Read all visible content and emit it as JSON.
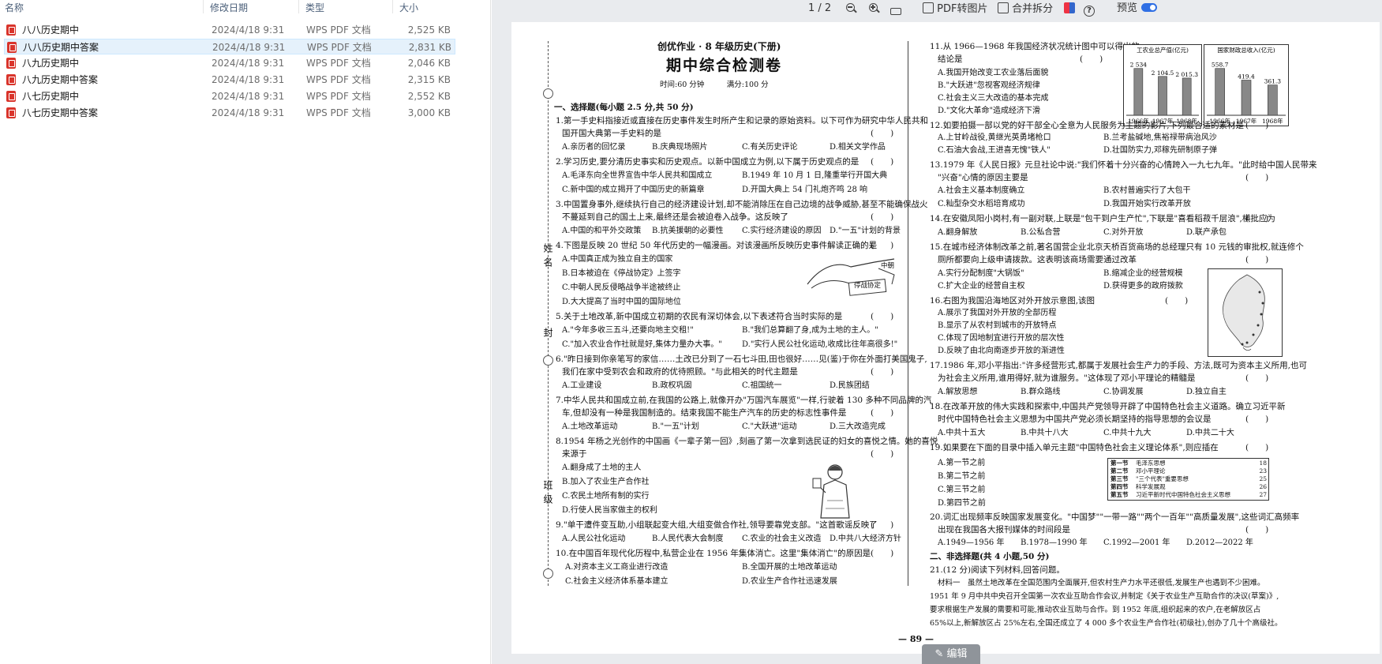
{
  "file_list": {
    "headers": {
      "name": "名称",
      "date": "修改日期",
      "type": "类型",
      "size": "大小"
    },
    "rows": [
      {
        "name": "八八历史期中",
        "date": "2024/4/18 9:31",
        "type": "WPS PDF 文档",
        "size": "2,525 KB"
      },
      {
        "name": "八八历史期中答案",
        "date": "2024/4/18 9:31",
        "type": "WPS PDF 文档",
        "size": "2,831 KB"
      },
      {
        "name": "八九历史期中",
        "date": "2024/4/18 9:31",
        "type": "WPS PDF 文档",
        "size": "2,046 KB"
      },
      {
        "name": "八九历史期中答案",
        "date": "2024/4/18 9:31",
        "type": "WPS PDF 文档",
        "size": "2,315 KB"
      },
      {
        "name": "八七历史期中",
        "date": "2024/4/18 9:31",
        "type": "WPS PDF 文档",
        "size": "2,552 KB"
      },
      {
        "name": "八七历史期中答案",
        "date": "2024/4/18 9:31",
        "type": "WPS PDF 文档",
        "size": "3,000 KB"
      }
    ]
  },
  "toolbar": {
    "page_indicator": "1 / 2",
    "pdf_to_image": "PDF转图片",
    "merge_split": "合并拆分",
    "preview": "预览",
    "preview_on": true
  },
  "edit_button": "编辑",
  "paper": {
    "header": "创优作业 · 8 年级历史(下册)",
    "title": "期中综合检测卷",
    "time_score": "时间:60 分钟　　　满分:100 分",
    "bind_name": "姓名",
    "bind_class": "班级",
    "bind_seal": "封",
    "section1": "一、选择题(每小题 2.5 分,共 50 分)",
    "q1": "1.第一手史料指接近或直接在历史事件发生时所产生和记录的原始资料。以下可作为研究中华人民共和",
    "q1b": "国开国大典第一手史料的是",
    "q1o": [
      "A.亲历者的回忆录",
      "B.庆典现场照片",
      "C.有关历史评论",
      "D.相关文学作品"
    ],
    "q2": "2.学习历史,要分清历史事实和历史观点。以新中国成立为例,以下属于历史观点的是",
    "q2o": [
      "A.毛泽东向全世界宣告中华人民共和国成立",
      "B.1949 年 10 月 1 日,隆重举行开国大典",
      "C.新中国的成立揭开了中国历史的新篇章",
      "D.开国大典上 54 门礼炮齐鸣 28 响"
    ],
    "q3": "3.中国置身事外,继续执行自己的经济建设计划,却不能消除压在自己边境的战争威胁,甚至不能确保战火",
    "q3b": "不蔓延到自己的国土上来,最终还是会被迫卷入战争。这反映了",
    "q3o": [
      "A.中国的和平外交政策",
      "B.抗美援朝的必要性",
      "C.实行经济建设的原因",
      "D.\"一五\"计划的背景"
    ],
    "q4": "4.下图是反映 20 世纪 50 年代历史的一幅漫画。对该漫画所反映历史事件解读正确的是",
    "q4o": [
      "A.中国真正成为独立自主的国家",
      "B.日本被迫在《停战协定》上签字",
      "C.中朝人民反侵略战争半途被终止",
      "D.大大提高了当时中国的国际地位"
    ],
    "q4_caption1": "中朝",
    "q4_caption2": "停战协定",
    "q5": "5.关于土地改革,新中国成立初期的农民有深切体会,以下表述符合当时实际的是",
    "q5o": [
      "A.\"今年多收三五斗,还要向地主交租!\"",
      "B.\"我们总算翻了身,成为土地的主人。\"",
      "C.\"加入农业合作社就是好,集体力量办大事。\"",
      "D.\"实行人民公社化运动,收成比往年高很多!\""
    ],
    "q6": "6.\"昨日接到你亲笔写的家信……土改已分到了一石七斗田,田也很好……见(鉴)于你在外面打美国鬼子,",
    "q6b": "我们在家中受到农会和政府的优待照顾。\"与此相关的时代主题是",
    "q6o": [
      "A.工业建设",
      "B.政权巩固",
      "C.祖国统一",
      "D.民族团结"
    ],
    "q7": "7.中华人民共和国成立前,在我国的公路上,就像开办\"万国汽车展览\"一样,行驶着 130 多种不同品牌的汽",
    "q7b": "车,但却没有一种是我国制造的。结束我国不能生产汽车的历史的标志性事件是",
    "q7o": [
      "A.土地改革运动",
      "B.\"一五\"计划",
      "C.\"大跃进\"运动",
      "D.三大改造完成"
    ],
    "q8": "8.1954 年杨之光创作的中国画《一辈子第一回》,刻画了第一次拿到选民证的妇女的喜悦之情。她的喜悦",
    "q8b": "来源于",
    "q8o": [
      "A.翻身成了土地的主人",
      "B.加入了农业生产合作社",
      "C.农民土地所有制的实行",
      "D.行使人民当家做主的权利"
    ],
    "q9": "9.\"单干遭件变互助,小组联起变大组,大组变做合作社,领导要靠党支部。\"这首歌谣反映了",
    "q9o": [
      "A.人民公社化运动",
      "B.人民代表大会制度",
      "C.农业的社会主义改造",
      "D.中共八大经济方针"
    ],
    "q10": "10.在中国百年现代化历程中,私营企业在 1956 年集体消亡。这里\"集体消亡\"的原因是",
    "q10o": [
      "A.对资本主义工商业进行改造",
      "B.全国开展的土地改革运动",
      "C.社会主义经济体系基本建立",
      "D.农业生产合作社迅速发展"
    ],
    "q11": "11.从 1966—1968 年我国经济状况统计图中可以得出的",
    "q11b": "结论是",
    "q11o": [
      "A.我国开始改变工农业落后面貌",
      "B.\"大跃进\"忽视客观经济规律",
      "C.社会主义三大改造的基本完成",
      "D.\"文化大革命\"造成经济下滑"
    ],
    "q12": "12.如要拍摄一部以党的好干部全心全意为人民服务为主题的影片,下列最合适的素材是",
    "q12o": [
      "A.上甘岭战役,黄继光英勇堵枪口",
      "B.兰考盐碱地,焦裕禄带病治风沙",
      "C.石油大会战,王进喜无愧\"铁人\"",
      "D.壮国防实力,邓稼先研制原子弹"
    ],
    "q13": "13.1979 年《人民日报》元旦社论中说:\"我们怀着十分兴奋的心情跨入一九七九年。\"此时给中国人民带来",
    "q13b": "\"兴奋\"心情的原因主要是",
    "q13o": [
      "A.社会主义基本制度确立",
      "B.农村普遍实行了大包干",
      "C.籼型杂交水稻培育成功",
      "D.我国开始实行改革开放"
    ],
    "q14": "14.在安徽凤阳小岗村,有一副对联,上联是\"包干到户生产忙\",下联是\"喜看稻菽千层浪\",横批应为",
    "q14o": [
      "A.翻身解放",
      "B.公私合营",
      "C.对外开放",
      "D.联产承包"
    ],
    "q15": "15.在城市经济体制改革之前,著名国营企业北京天桥百货商场的总经理只有 10 元钱的审批权,就连修个",
    "q15b": "厕所都要向上级申请拨款。这表明该商场需要通过改革",
    "q15o": [
      "A.实行分配制度\"大锅饭\"",
      "B.缩减企业的经营规模",
      "C.扩大企业的经营自主权",
      "D.获得更多的政府拨款"
    ],
    "q16": "16.右图为我国沿海地区对外开放示意图,该图",
    "q16o": [
      "A.展示了我国对外开放的全部历程",
      "B.显示了从农村到城市的开放特点",
      "C.体现了因地制宜进行开放的层次性",
      "D.反映了由北向南逐步开放的渐进性"
    ],
    "q17": "17.1986 年,邓小平指出:\"许多经营形式,都属于发展社会生产力的手段、方法,既可为资本主义所用,也可",
    "q17b": "为社会主义所用,谁用得好,就为谁服务。\"这体现了邓小平理论的精髓是",
    "q17o": [
      "A.解放思想",
      "B.群众路线",
      "C.协调发展",
      "D.独立自主"
    ],
    "q18": "18.在改革开放的伟大实践和探索中,中国共产党领导开辟了中国特色社会主义道路。确立习近平新",
    "q18b": "时代中国特色社会主义思想为中国共产党必须长期坚持的指导思想的会议是",
    "q18o": [
      "A.中共十五大",
      "B.中共十八大",
      "C.中共十九大",
      "D.中共二十大"
    ],
    "q19": "19.如果要在下面的目录中插入单元主题\"中国特色社会主义理论体系\",则应插在",
    "q19o": [
      "A.第一节之前",
      "B.第二节之前",
      "C.第三节之前",
      "D.第四节之前"
    ],
    "q19_table": [
      {
        "sec": "第一节",
        "name": "毛泽东思想",
        "page": "18"
      },
      {
        "sec": "第二节",
        "name": "邓小平理论",
        "page": "23"
      },
      {
        "sec": "第三节",
        "name": "\"三个代表\"重要思想",
        "page": "25"
      },
      {
        "sec": "第四节",
        "name": "科学发展观",
        "page": "26"
      },
      {
        "sec": "第五节",
        "name": "习近平新时代中国特色社会主义思想",
        "page": "27"
      }
    ],
    "q20": "20.词汇出现频率反映国家发展变化。\"中国梦\"\"一带一路\"\"两个一百年\"\"高质量发展\",这些词汇高频率",
    "q20b": "出现在我国各大报刊媒体的时间段是",
    "q20o": [
      "A.1949—1956 年",
      "B.1978—1990 年",
      "C.1992—2001 年",
      "D.2012—2022 年"
    ],
    "section2": "二、非选择题(共 4 小题,50 分)",
    "q21": "21.(12 分)阅读下列材料,回答问题。",
    "mat1": "材料一　虽然土地改革在全国范围内全面展开,但农村生产力水平还很低,发展生产也遇到不少困难。",
    "mat2": "1951 年 9 月中共中央召开全国第一次农业互助合作会议,并制定《关于农业生产互助合作的决议(草案)》,",
    "mat3": "要求根据生产发展的需要和可能,推动农业互助与合作。到 1952 年底,组织起来的农户,在老解放区占",
    "mat4": "65%以上,新解放区占 25%左右,全国还成立了 4 000 多个农业生产合作社(初级社),创办了几十个高级社。",
    "paren": "(　　)",
    "page_number": "— 89 —"
  },
  "chart_data": [
    {
      "type": "bar",
      "title": "工农业总产值(亿元)",
      "categories": [
        "1966年",
        "1967年",
        "1968年"
      ],
      "values": [
        2534,
        2104.5,
        2015.3
      ],
      "labels": [
        "2 534",
        "2 104.5",
        "2 015.3"
      ],
      "xlabel": "",
      "ylabel": ""
    },
    {
      "type": "bar",
      "title": "国家财政总收入(亿元)",
      "categories": [
        "1966年",
        "1967年",
        "1968年"
      ],
      "values": [
        558.7,
        419.4,
        361.3
      ],
      "labels": [
        "558.7",
        "419.4",
        "361.3"
      ],
      "xlabel": "",
      "ylabel": ""
    }
  ]
}
